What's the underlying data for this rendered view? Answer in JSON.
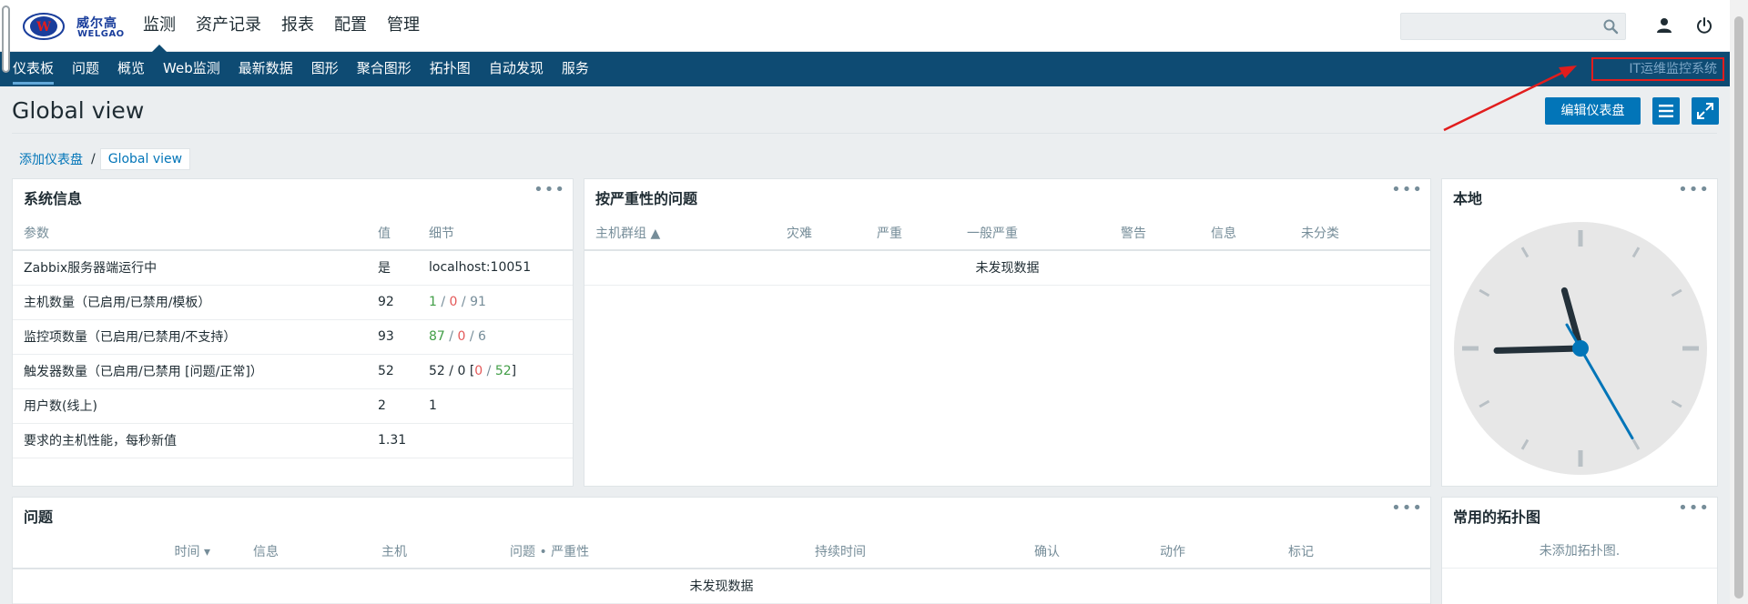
{
  "header": {
    "logo": {
      "cn": "威尔高",
      "en": "WELGAO"
    },
    "main_nav": [
      {
        "label": "监测",
        "active": true
      },
      {
        "label": "资产记录",
        "active": false
      },
      {
        "label": "报表",
        "active": false
      },
      {
        "label": "配置",
        "active": false
      },
      {
        "label": "管理",
        "active": false
      }
    ],
    "search": {
      "value": "",
      "placeholder": ""
    }
  },
  "sub_nav": {
    "items": [
      {
        "label": "仪表板",
        "active": true
      },
      {
        "label": "问题",
        "active": false
      },
      {
        "label": "概览",
        "active": false
      },
      {
        "label": "Web监测",
        "active": false
      },
      {
        "label": "最新数据",
        "active": false
      },
      {
        "label": "图形",
        "active": false
      },
      {
        "label": "聚合图形",
        "active": false
      },
      {
        "label": "拓扑图",
        "active": false
      },
      {
        "label": "自动发现",
        "active": false
      },
      {
        "label": "服务",
        "active": false
      }
    ],
    "system_label": "IT运维监控系统"
  },
  "page": {
    "title": "Global view",
    "edit_button": "编辑仪表盘",
    "breadcrumb": {
      "parent": "添加仪表盘",
      "separator": "/",
      "current": "Global view"
    }
  },
  "widgets": {
    "system_info": {
      "title": "系统信息",
      "columns": [
        "参数",
        "值",
        "细节"
      ],
      "rows": [
        {
          "param": "Zabbix服务器端运行中",
          "value": "是",
          "detail": "localhost:10051"
        },
        {
          "param": "主机数量（已启用/已禁用/模板）",
          "value": "92",
          "d1": "1",
          "d2": "0",
          "d3": "91"
        },
        {
          "param": "监控项数量（已启用/已禁用/不支持）",
          "value": "93",
          "d1": "87",
          "d2": "0",
          "d3": "6"
        },
        {
          "param": "触发器数量（已启用/已禁用 [问题/正常]）",
          "value": "52",
          "d1": "52",
          "d2": "0",
          "d3": "0",
          "d4": "52"
        },
        {
          "param": "用户数(线上)",
          "value": "2",
          "d1": "1"
        },
        {
          "param": "要求的主机性能，每秒新值",
          "value": "1.31"
        }
      ]
    },
    "problems_by_severity": {
      "title": "按严重性的问题",
      "columns": [
        "主机群组 ▲",
        "灾难",
        "严重",
        "一般严重",
        "警告",
        "信息",
        "未分类"
      ],
      "empty": "未发现数据"
    },
    "clock": {
      "title": "本地",
      "hour": 8,
      "minute": 57,
      "second": 25
    },
    "problems": {
      "title": "问题",
      "columns": [
        "时间 ▾",
        "信息",
        "主机",
        "问题 • 严重性",
        "持续时间",
        "确认",
        "动作",
        "标记"
      ],
      "empty": "未发现数据"
    },
    "favourite_maps": {
      "title": "常用的拓扑图",
      "empty": "未添加拓扑图."
    }
  },
  "colors": {
    "nav_bg": "#0e4b73",
    "accent": "#0275b8",
    "ok": "#429e47",
    "problem": "#e45959",
    "annotation": "#e11d1d"
  }
}
